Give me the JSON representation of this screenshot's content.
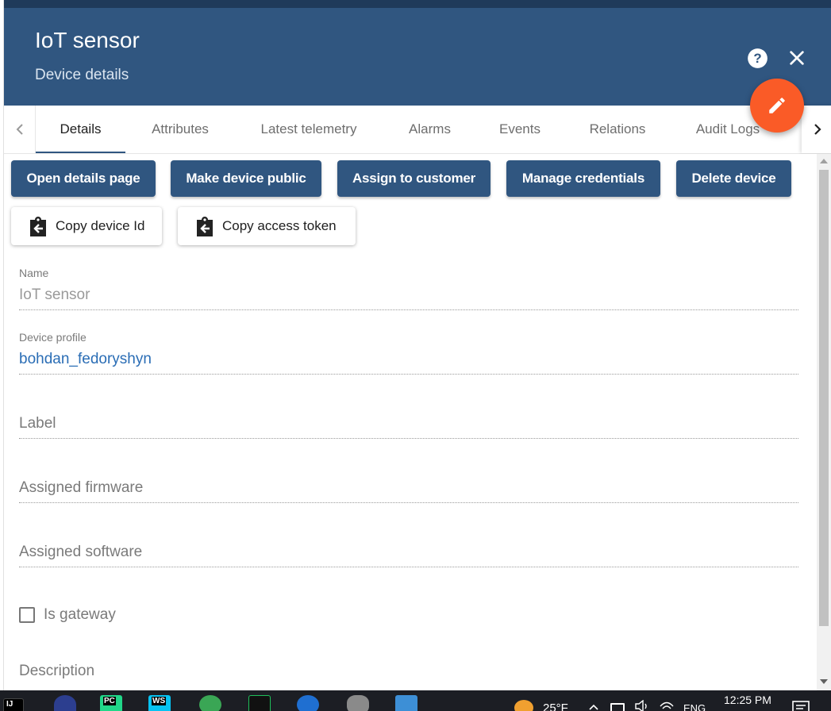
{
  "header": {
    "title": "IoT sensor",
    "subtitle": "Device details"
  },
  "tabs": [
    {
      "label": "Details",
      "active": true
    },
    {
      "label": "Attributes"
    },
    {
      "label": "Latest telemetry"
    },
    {
      "label": "Alarms"
    },
    {
      "label": "Events"
    },
    {
      "label": "Relations"
    },
    {
      "label": "Audit Logs"
    }
  ],
  "actions": {
    "open_details": "Open details page",
    "make_public": "Make device public",
    "assign_customer": "Assign to customer",
    "manage_credentials": "Manage credentials",
    "delete_device": "Delete device",
    "copy_device_id": "Copy device Id",
    "copy_access_token": "Copy access token"
  },
  "form": {
    "name_label": "Name",
    "name_value": "IoT sensor",
    "profile_label": "Device profile",
    "profile_value": "bohdan_fedoryshyn",
    "label_placeholder": "Label",
    "firmware_placeholder": "Assigned firmware",
    "software_placeholder": "Assigned software",
    "is_gateway_label": "Is gateway",
    "is_gateway_checked": false,
    "description_placeholder": "Description"
  },
  "taskbar": {
    "weather": "25°F",
    "language": "ENG",
    "time": "12:25 PM",
    "apps": [
      "IJ",
      "PC",
      "WS"
    ]
  },
  "colors": {
    "header_bg": "#305680",
    "fab": "#fa5b27",
    "link": "#2a6db5"
  }
}
